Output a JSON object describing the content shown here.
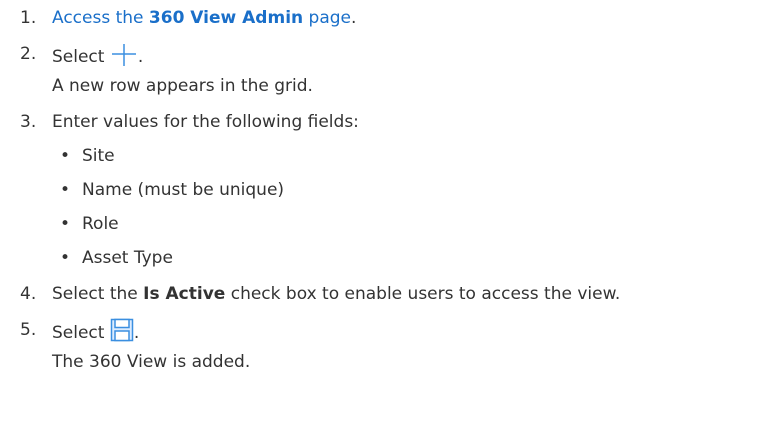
{
  "steps": [
    {
      "num": "1.",
      "pre": "Access the ",
      "link_bold": "360 View Admin",
      "post": " page",
      "end": "."
    },
    {
      "num": "2.",
      "pre": "Select ",
      "icon": "plus-icon",
      "end": ".",
      "result": "A new row appears in the grid."
    },
    {
      "num": "3.",
      "text": "Enter values for the following fields:",
      "items": [
        "Site",
        "Name (must be unique)",
        "Role",
        "Asset Type"
      ]
    },
    {
      "num": "4.",
      "pre": "Select the ",
      "bold": "Is Active",
      "post": " check box to enable users to access the view."
    },
    {
      "num": "5.",
      "pre": "Select ",
      "icon": "save-icon",
      "end": ".",
      "result": "The 360 View is added."
    }
  ],
  "bullet": "•",
  "colors": {
    "link": "#1a6fc9",
    "text": "#333333",
    "icon": "#3b8fe0"
  }
}
